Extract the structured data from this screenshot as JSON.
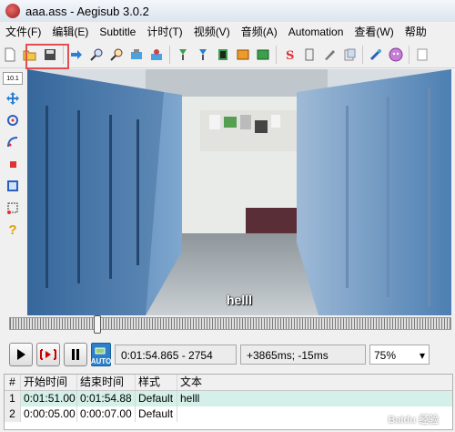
{
  "window": {
    "title": "aaa.ass - Aegisub 3.0.2"
  },
  "menu": [
    "文件(F)",
    "编辑(E)",
    "Subtitle",
    "计时(T)",
    "视频(V)",
    "音频(A)",
    "Automation",
    "查看(W)",
    "帮助"
  ],
  "toolbar_icons": [
    "new-file-icon",
    "open-file-icon",
    "save-file-icon",
    "jump-to-icon",
    "zoom-in-icon",
    "zoom-out-icon",
    "video-snap-icon",
    "audio-snap-icon",
    "shift-times-icon",
    "style-manager-icon",
    "properties-icon",
    "attachments-icon",
    "fonts-collector-icon",
    "translate-icon",
    "spellcheck-icon",
    "styling-assistant-icon",
    "automation-icon",
    "options-icon",
    "help-icon"
  ],
  "lefttools": {
    "scale": "10.1",
    "tool_icons": [
      "move-icon",
      "rotate-z-icon",
      "rotate-xy-icon",
      "scale-icon",
      "clip-rect-icon",
      "vector-clip-icon",
      "help-icon"
    ]
  },
  "video": {
    "subtitle": "helll"
  },
  "controls": {
    "auto_label": "AUTO",
    "time": "0:01:54.865 - 2754",
    "offset": "+3865ms; -15ms",
    "zoom": "75%"
  },
  "grid": {
    "headers": [
      "#",
      "开始时间",
      "结束时间",
      "样式",
      "文本"
    ],
    "rows": [
      {
        "num": "1",
        "start": "0:01:51.00",
        "end": "0:01:54.88",
        "style": "Default",
        "text": "helll"
      },
      {
        "num": "2",
        "start": "0:00:05.00",
        "end": "0:00:07.00",
        "style": "Default",
        "text": ""
      }
    ]
  },
  "watermark": "Baidu 经验",
  "colors": {
    "accent": "#2c7fc9",
    "selected_row": "#d4f0e8",
    "highlight": "#e05050"
  }
}
